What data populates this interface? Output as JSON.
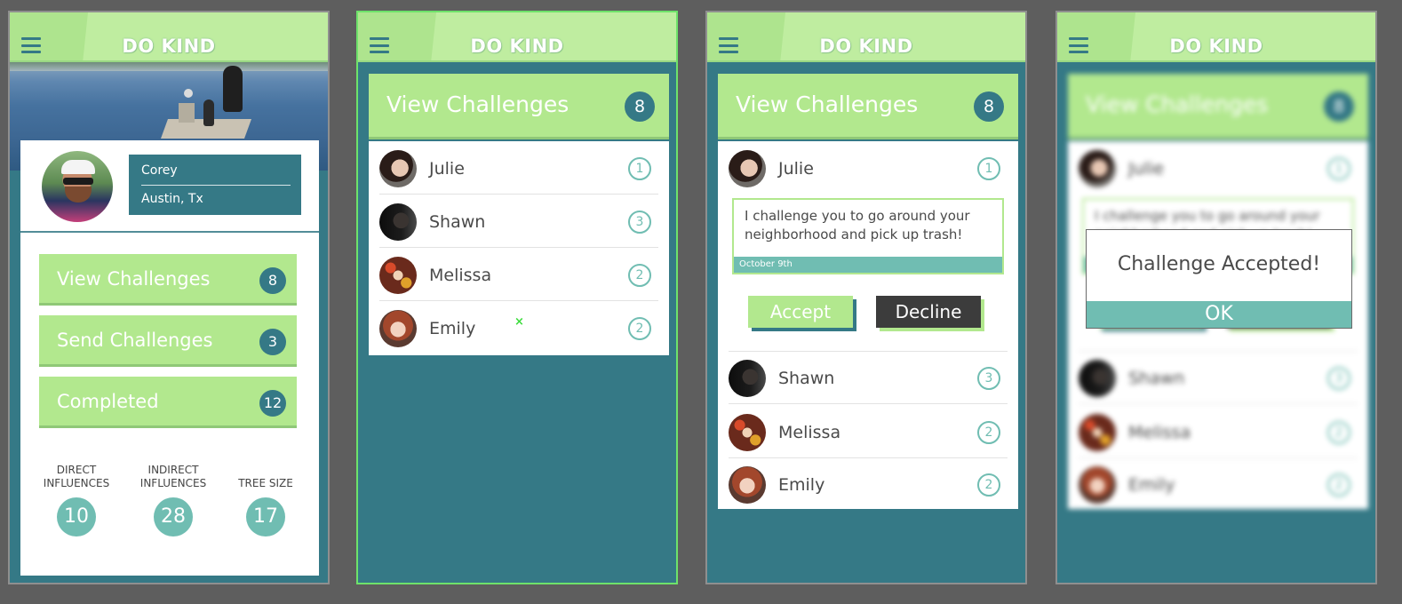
{
  "app": {
    "logo": "DO KIND"
  },
  "profile": {
    "name": "Corey",
    "location": "Austin, Tx"
  },
  "menu": {
    "view_challenges": {
      "label": "View Challenges",
      "count": "8"
    },
    "send_challenges": {
      "label": "Send Challenges",
      "count": "3"
    },
    "completed": {
      "label": "Completed",
      "count": "12"
    }
  },
  "stats": [
    {
      "label": "DIRECT INFLUENCES",
      "value": "10"
    },
    {
      "label": "INDIRECT INFLUENCES",
      "value": "28"
    },
    {
      "label": "TREE SIZE",
      "value": "17"
    }
  ],
  "challenges": {
    "header": "View Challenges",
    "count": "8",
    "list": [
      {
        "name": "Julie",
        "count": "1"
      },
      {
        "name": "Shawn",
        "count": "3"
      },
      {
        "name": "Melissa",
        "count": "2"
      },
      {
        "name": "Emily",
        "count": "2"
      }
    ],
    "x_mark": "×"
  },
  "detail": {
    "message": "I challenge you to go around your neighborhood and pick up trash!",
    "date": "October 9th",
    "accept": "Accept",
    "decline": "Decline"
  },
  "modal": {
    "message": "Challenge Accepted!",
    "ok": "OK"
  },
  "colors": {
    "teal": "#357986",
    "light_green": "#b2e88e",
    "header_green": "#bfeda0",
    "mint": "#70bdb2",
    "dark": "#3c3c3c"
  }
}
